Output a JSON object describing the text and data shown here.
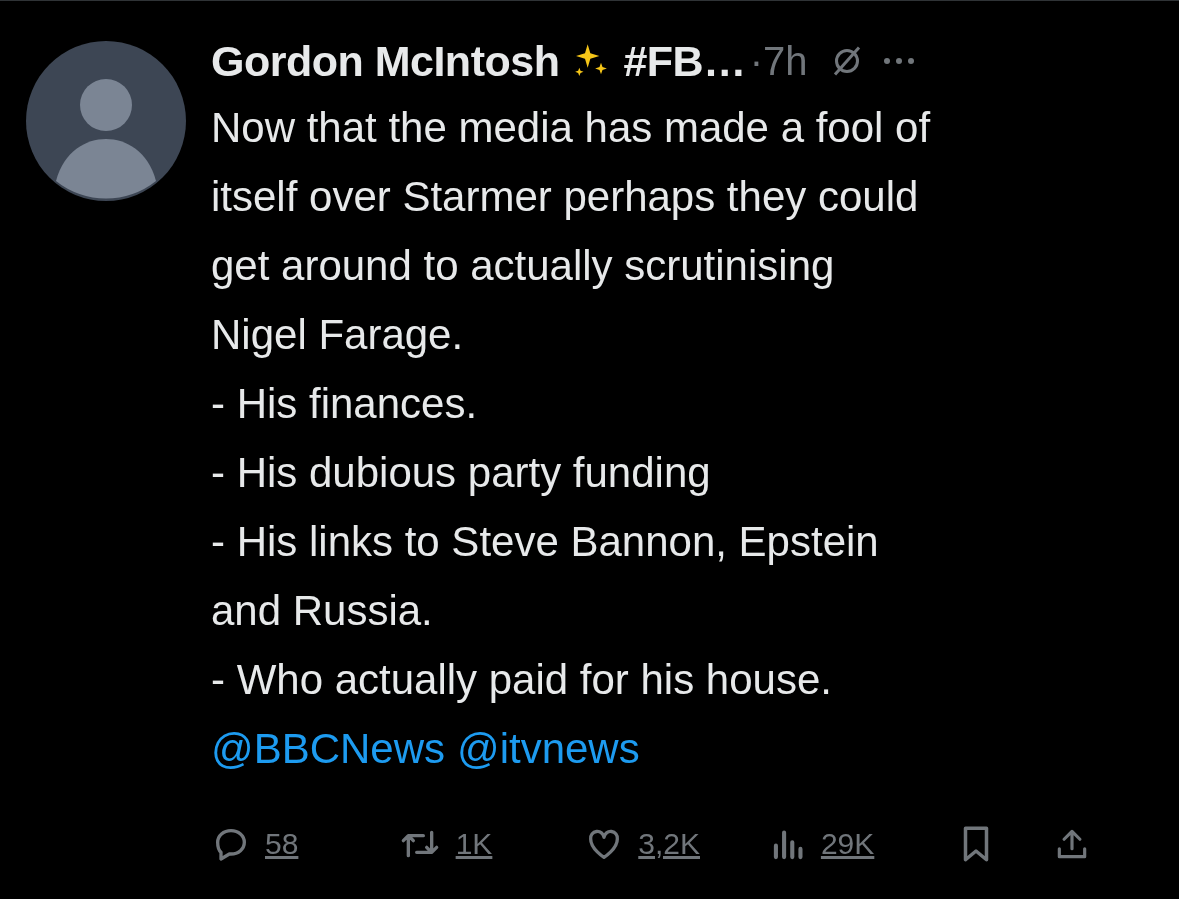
{
  "post": {
    "author": "Gordon McIntosh",
    "name_suffix": "#FB…",
    "separator": "·",
    "time": "7h",
    "text_lines": [
      "Now that the media has made a fool of",
      "itself over Starmer perhaps they could",
      "get around to actually scrutinising",
      "Nigel Farage.",
      "- His finances.",
      "- His dubious party funding",
      "- His links to Steve Bannon, Epstein",
      "and Russia.",
      "- Who actually paid for his house."
    ],
    "mentions": [
      "@BBCNews",
      "@itvnews"
    ],
    "actions": [
      {
        "kind": "reply",
        "count": "58"
      },
      {
        "kind": "repost",
        "count": "1K"
      },
      {
        "kind": "like",
        "count": "3,2K"
      },
      {
        "kind": "views",
        "count": "29K"
      },
      {
        "kind": "bookmark"
      },
      {
        "kind": "share"
      }
    ]
  }
}
